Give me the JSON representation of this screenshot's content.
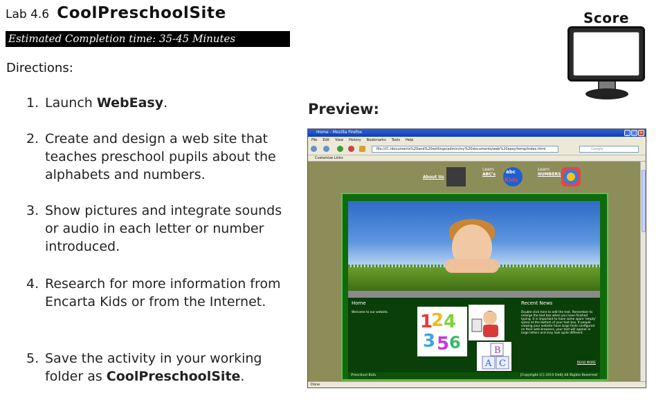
{
  "header": {
    "lab_number": "Lab 4.6",
    "lab_title": "CoolPreschoolSite",
    "estimated_time": "Estimated Completion time: 35-45 Minutes",
    "directions_label": "Directions:"
  },
  "score_label": "Score",
  "preview_label": "Preview:",
  "steps": [
    {
      "num": "1.",
      "before": "Launch ",
      "bold": "WebEasy",
      "after": "."
    },
    {
      "num": "2.",
      "before": "Create and design a web site that teaches preschool pupils about the alphabets and numbers.",
      "bold": "",
      "after": ""
    },
    {
      "num": "3.",
      "before": "Show pictures and integrate sounds or audio in each letter or number introduced.",
      "bold": "",
      "after": ""
    },
    {
      "num": "4.",
      "before": "Research for more information from Encarta Kids or from the Internet.",
      "bold": "",
      "after": ""
    },
    {
      "num": "5.",
      "before": "Save the activity in your working folder as ",
      "bold": "CoolPreschoolSite",
      "after": "."
    }
  ],
  "browser": {
    "title": "Home - Mozilla Firefox",
    "menu": [
      "File",
      "Edit",
      "View",
      "History",
      "Bookmarks",
      "Tools",
      "Help"
    ],
    "url": "file:///C:/documents%20and%20settings/admin/my%20documents/web%20easy/temp/index.html",
    "search_placeholder": "Google",
    "bookmark": "Customize Links",
    "status": "Done",
    "site": {
      "nav_about": "About Us",
      "nav_learn1_top": "Learn",
      "nav_learn1_link": "ABC's",
      "nav_learn2_top": "Learn",
      "nav_learn2_link": "NUMBERS",
      "home_title": "Home",
      "home_text": "Welcome to our website.",
      "news_title": "Recent News",
      "news_text": "Double-click here to edit the text. Remember to enlarge the text box when you have finished typing. It is important to have some spare 'empty' space at the bottom of your text box. If people viewing your website have large fonts configured on their web browsers, your text will appear in large letters and may look quite different.",
      "read_more": "READ MORE",
      "footer_left": "Preschool Kids",
      "footer_right": "[Copyright (C) 2010 Dell] All Rights Reserved",
      "abc_badge": "abc",
      "kids_badge": "Kids"
    }
  }
}
